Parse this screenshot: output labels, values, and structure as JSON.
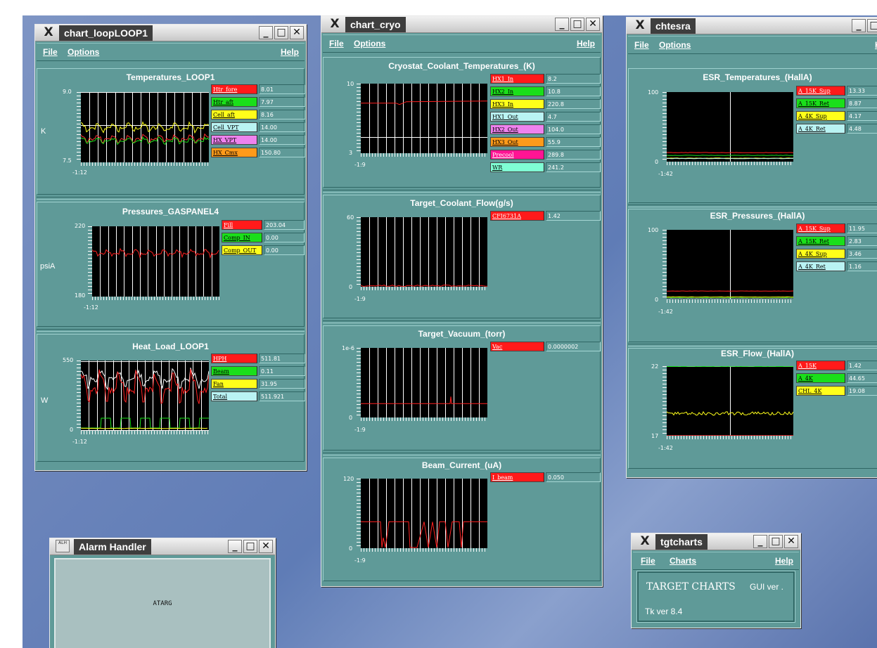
{
  "windows": {
    "loop": {
      "title": "chart_loopLOOP1",
      "menu": {
        "file": "File",
        "options": "Options",
        "help": "Help"
      },
      "charts": [
        {
          "title": "Temperatures_LOOP1",
          "ylabel": "K",
          "ymax": "9.0",
          "ymin": "7.5",
          "xstart": "-1:12",
          "legend": [
            {
              "label": "Htr_fore",
              "value": "8.01",
              "color": "#ff1a1a"
            },
            {
              "label": "Htr_aft",
              "value": "7.97",
              "color": "#1adf1a"
            },
            {
              "label": "Cell_aft",
              "value": "8.16",
              "color": "#ffff1a"
            },
            {
              "label": "Cell_VPT",
              "value": "14.00",
              "color": "#b9f3f3"
            },
            {
              "label": "HX_VPT",
              "value": "14.00",
              "color": "#ee82ee"
            },
            {
              "label": "HX_Cmx",
              "value": "150.80",
              "color": "#ff9a1a"
            }
          ]
        },
        {
          "title": "Pressures_GASPANEL4",
          "ylabel": "psiA",
          "ymax": "220",
          "ymin": "180",
          "xstart": "-1:12",
          "legend": [
            {
              "label": "Fill",
              "value": "203.04",
              "color": "#ff1a1a"
            },
            {
              "label": "Comp_IN",
              "value": "0.00",
              "color": "#1adf1a"
            },
            {
              "label": "Comp_OUT",
              "value": "0.00",
              "color": "#ffff1a"
            }
          ]
        },
        {
          "title": "Heat_Load_LOOP1",
          "ylabel": "W",
          "ymax": "550",
          "ymin": "0",
          "xstart": "-1:12",
          "legend": [
            {
              "label": "HPH",
              "value": "511.81",
              "color": "#ff1a1a"
            },
            {
              "label": "Beam",
              "value": "0.11",
              "color": "#1adf1a"
            },
            {
              "label": "Fan",
              "value": "31.95",
              "color": "#ffff1a"
            },
            {
              "label": "Total",
              "value": "511.921",
              "color": "#b9f3f3"
            }
          ]
        }
      ]
    },
    "cryo": {
      "title": "chart_cryo",
      "menu": {
        "file": "File",
        "options": "Options",
        "help": "Help"
      },
      "charts": [
        {
          "title": "Cryostat_Coolant_Temperatures_(K)",
          "ymax": "10",
          "ymin": "3",
          "xstart": "-1:9",
          "legend": [
            {
              "label": "HX1_In",
              "value": "8.2",
              "color": "#ff1a1a"
            },
            {
              "label": "HX2_In",
              "value": "10.8",
              "color": "#1adf1a"
            },
            {
              "label": "HX3_In",
              "value": "220.8",
              "color": "#ffff1a"
            },
            {
              "label": "HX1_Out",
              "value": "4.7",
              "color": "#b9f3f3"
            },
            {
              "label": "HX2_Out",
              "value": "104.0",
              "color": "#ee82ee"
            },
            {
              "label": "HX3_Out",
              "value": "55.9",
              "color": "#ff9a1a"
            },
            {
              "label": "Precool",
              "value": "289.8",
              "color": "#ff1493"
            },
            {
              "label": "WR",
              "value": "241.2",
              "color": "#7fffd4"
            }
          ]
        },
        {
          "title": "Target_Coolant_Flow(g/s)",
          "ymax": "60",
          "ymin": "0",
          "xstart": "-1:9",
          "legend": [
            {
              "label": "CFI6731A",
              "value": "1.42",
              "color": "#ff1a1a"
            }
          ]
        },
        {
          "title": "Target_Vacuum_(torr)",
          "ymax": "1e-6",
          "ymin": "0",
          "xstart": "-1:9",
          "legend": [
            {
              "label": "Vac",
              "value": "0.0000002",
              "color": "#ff1a1a"
            }
          ]
        },
        {
          "title": "Beam_Current_(uA)",
          "ymax": "120",
          "ymin": "0",
          "xstart": "-1:9",
          "legend": [
            {
              "label": "I_beam",
              "value": "0.050",
              "color": "#ff1a1a"
            }
          ]
        }
      ]
    },
    "esr": {
      "title": "chtesra",
      "menu": {
        "file": "File",
        "options": "Options",
        "help": "H"
      },
      "charts": [
        {
          "title": "ESR_Temperatures_(HallA)",
          "ymax": "100",
          "ymin": "0",
          "xstart": "-1:42",
          "legend": [
            {
              "label": "A_15K_Sup",
              "value": "13.33",
              "color": "#ff1a1a"
            },
            {
              "label": "A_15K_Ret",
              "value": "8.87",
              "color": "#1adf1a"
            },
            {
              "label": "A_4K_Sup",
              "value": "4.17",
              "color": "#ffff1a"
            },
            {
              "label": "A_4K_Ret",
              "value": "4.48",
              "color": "#b9f3f3"
            }
          ]
        },
        {
          "title": "ESR_Pressures_(HallA)",
          "ymax": "100",
          "ymin": "0",
          "xstart": "-1:42",
          "legend": [
            {
              "label": "A_15K_Sup",
              "value": "11.95",
              "color": "#ff1a1a"
            },
            {
              "label": "A_15K_Ret",
              "value": "2.83",
              "color": "#1adf1a"
            },
            {
              "label": "A_4K_Sup",
              "value": "3.46",
              "color": "#ffff1a"
            },
            {
              "label": "A_4K_Ret",
              "value": "1.16",
              "color": "#b9f3f3"
            }
          ]
        },
        {
          "title": "ESR_Flow_(HallA)",
          "ymax": "22",
          "ymin": "17",
          "xstart": "-1:42",
          "legend": [
            {
              "label": "A_15K",
              "value": "1.42",
              "color": "#ff1a1a"
            },
            {
              "label": "A_4K",
              "value": "44.65",
              "color": "#1adf1a"
            },
            {
              "label": "CHL_4K",
              "value": "19.08",
              "color": "#ffff1a"
            }
          ]
        }
      ]
    },
    "alarm": {
      "title": "Alarm Handler",
      "icon_text": "ALH",
      "body_text": "ATARG"
    },
    "tgt": {
      "title": "tgtcharts",
      "menu": {
        "file": "File",
        "charts": "Charts",
        "help": "Help"
      },
      "heading": "TARGET CHARTS",
      "gui": "GUI ver .",
      "tk": "Tk ver 8.4"
    }
  }
}
